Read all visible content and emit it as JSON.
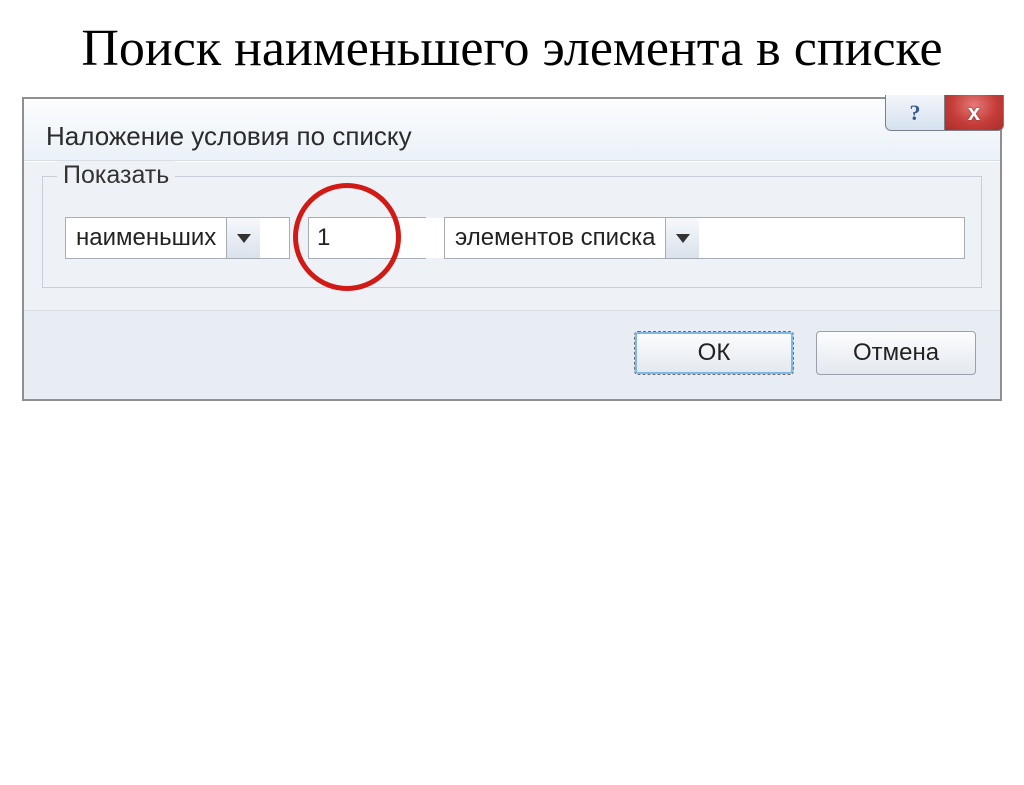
{
  "page": {
    "title": "Поиск наименьшего элемента в списке"
  },
  "dialog": {
    "title": "Наложение условия по списку",
    "help_icon": "?",
    "close_icon": "x",
    "legend": "Показать",
    "dropdown1_value": "наименьших",
    "spin_value": "1",
    "dropdown2_value": "элементов списка",
    "ok_label": "ОК",
    "cancel_label": "Отмена"
  }
}
